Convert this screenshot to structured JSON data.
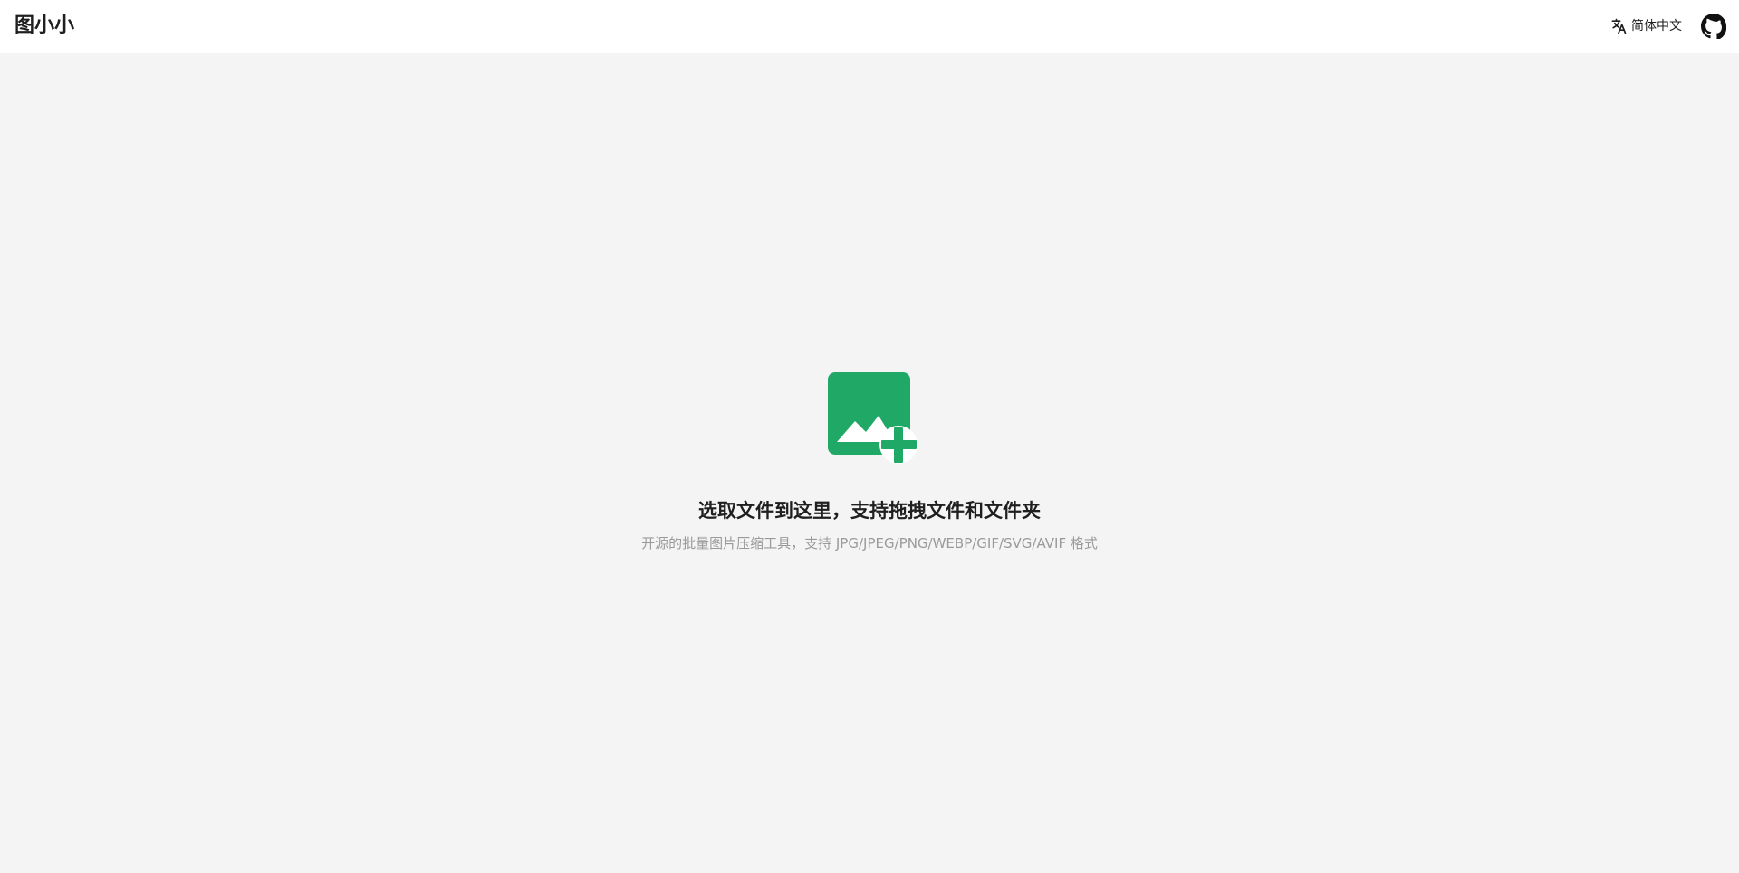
{
  "app": {
    "name": "图小小"
  },
  "header": {
    "language_label": "简体中文",
    "language_icon": "translate-icon",
    "github_icon": "github-icon"
  },
  "upload": {
    "icon": "add-image-icon",
    "title": "选取文件到这里，支持拖拽文件和文件夹",
    "subtitle": "开源的批量图片压缩工具，支持 JPG/JPEG/PNG/WEBP/GIF/SVG/AVIF 格式"
  },
  "colors": {
    "accent": "#20a866",
    "header_background": "#ffffff",
    "page_background": "#f4f4f4",
    "primary_text": "#1f1f1f",
    "secondary_text": "#9a9a9a"
  }
}
